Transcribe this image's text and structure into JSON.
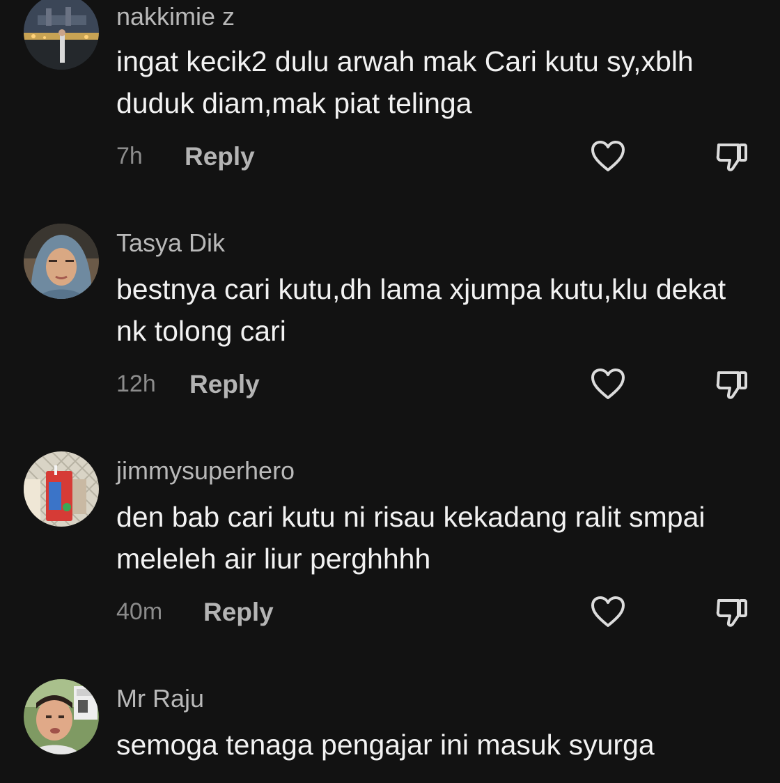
{
  "comments": [
    {
      "username": "nakkimie z",
      "text": "ingat kecik2 dulu arwah mak Cari kutu sy,xblh duduk diam,mak piat telinga",
      "time": "7h",
      "reply_label": "Reply",
      "avatar_icon": "avatar-photo-city-night"
    },
    {
      "username": "Tasya Dik",
      "text": "bestnya cari kutu,dh lama xjumpa kutu,klu dekat nk tolong cari",
      "time": "12h",
      "reply_label": "Reply",
      "avatar_icon": "avatar-photo-woman-hijab"
    },
    {
      "username": "jimmysuperhero",
      "text": "den bab cari kutu ni risau kekadang ralit smpai meleleh air liur perghhhh",
      "time": "40m",
      "reply_label": "Reply",
      "avatar_icon": "avatar-photo-drink-pack"
    },
    {
      "username": "Mr Raju",
      "text": "semoga tenaga pengajar ini masuk syurga",
      "avatar_icon": "avatar-photo-man-selfie"
    }
  ],
  "icons": {
    "like": "heart-outline-icon",
    "dislike": "thumbs-down-outline-icon"
  },
  "colors": {
    "background": "#121212",
    "username": "#b9b9b9",
    "comment_text": "#f2f2f2",
    "timestamp": "#8c8c8c",
    "reply": "#b4b4b4"
  }
}
